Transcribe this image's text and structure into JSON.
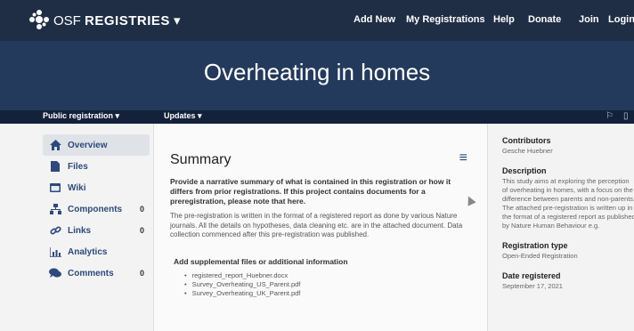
{
  "nav": {
    "brand_prefix": "OSF",
    "brand_name": "REGISTRIES",
    "brand_caret": "▾",
    "links": [
      "Add New",
      "My Registrations",
      "Help",
      "Donate",
      "Join",
      "Login"
    ]
  },
  "hero": {
    "title": "Overheating in homes"
  },
  "subbar": {
    "public_registration": "Public registration ▾",
    "updates": "Updates ▾"
  },
  "sidebar": {
    "items": [
      {
        "label": "Overview",
        "count": "",
        "icon": "home-icon"
      },
      {
        "label": "Files",
        "count": "",
        "icon": "file-icon"
      },
      {
        "label": "Wiki",
        "count": "",
        "icon": "wiki-icon"
      },
      {
        "label": "Components",
        "count": "0",
        "icon": "components-icon"
      },
      {
        "label": "Links",
        "count": "0",
        "icon": "link-icon"
      },
      {
        "label": "Analytics",
        "count": "",
        "icon": "analytics-icon"
      },
      {
        "label": "Comments",
        "count": "0",
        "icon": "comments-icon"
      }
    ]
  },
  "summary": {
    "title": "Summary",
    "prompt": "Provide a narrative summary of what is contained in this registration or how it differs from prior registrations. If this project contains documents for a preregistration, please note that here.",
    "description": "The pre-registration is written in the format of a registered report as done by various Nature journals. All the details on hypotheses, data cleaning etc. are in the attached document. Data collection commenced after this pre-registration was published.",
    "supplemental_title": "Add supplemental files or additional information",
    "files": [
      "registered_report_Huebner.docx",
      "Survey_Overheating_US_Parent.pdf",
      "Survey_Overheating_UK_Parent.pdf"
    ]
  },
  "details": {
    "contributors_label": "Contributors",
    "contributors": "Gesche Huebner",
    "description_label": "Description",
    "description": "This study aims at exploring the perception of overheating in homes, with a focus on the difference between parents and non-parents. The attached pre-registration is written up in the format of a registered report as published by Nature Human Behaviour e.g.",
    "registration_type_label": "Registration type",
    "registration_type": "Open-Ended Registration",
    "date_registered_label": "Date registered",
    "date_registered": "September 17, 2021"
  },
  "colors": {
    "nav_bg": "#1f2e45",
    "hero_bg": "#243a5c",
    "accent": "#2d4a7a"
  }
}
